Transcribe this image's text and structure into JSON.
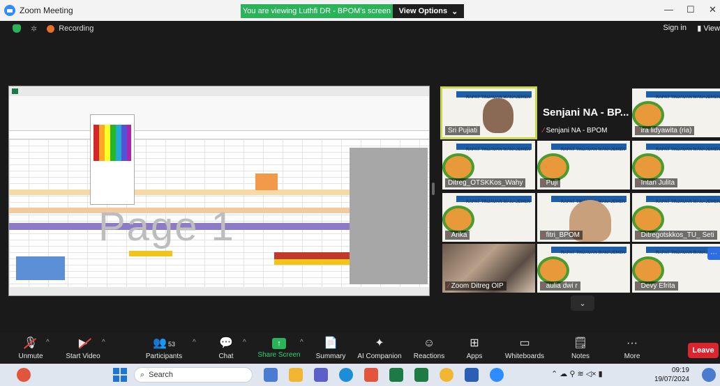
{
  "window": {
    "title": "Zoom Meeting",
    "share_banner": "You are viewing Luthfi DR - BPOM's screen",
    "view_options": "View Options",
    "controls": [
      "—",
      "☐",
      "✕"
    ]
  },
  "status": {
    "recording_label": "Recording",
    "sign_in": "Sign in",
    "view": "View"
  },
  "shared_screen": {
    "watermark": "Page 1"
  },
  "tiles": [
    {
      "name": "Sri Pujiati",
      "muted": false,
      "kind": "face"
    },
    {
      "name": "Senjani NA - BPOM",
      "big_label": "Senjani NA - BP...",
      "muted": true,
      "kind": "dark"
    },
    {
      "name": "ira lidyawita (ria)",
      "muted": true,
      "kind": "slide"
    },
    {
      "name": "Ditreg_OTSKKos_Wahy",
      "muted": false,
      "kind": "slide"
    },
    {
      "name": "Puji",
      "muted": true,
      "kind": "slide"
    },
    {
      "name": "Intan Julita",
      "muted": true,
      "kind": "slide"
    },
    {
      "name": "Arika",
      "muted": true,
      "kind": "slide"
    },
    {
      "name": "fitri_BPOM",
      "muted": true,
      "kind": "hijab"
    },
    {
      "name": "Ditregotskkos_TU_ Seti",
      "muted": true,
      "kind": "slide"
    },
    {
      "name": "Zoom Ditreg OIP",
      "muted": true,
      "kind": "photo"
    },
    {
      "name": "aulia dwi r",
      "muted": true,
      "kind": "slide"
    },
    {
      "name": "Devy Efrita",
      "muted": true,
      "kind": "slide"
    }
  ],
  "slide_header": "RAPAT TINJAUAN MANAJEMEN",
  "toolbar": {
    "unmute": "Unmute",
    "start_video": "Start Video",
    "participants": "Participants",
    "participants_count": "53",
    "chat": "Chat",
    "share_screen": "Share Screen",
    "summary": "Summary",
    "ai_companion": "AI Companion",
    "reactions": "Reactions",
    "apps": "Apps",
    "whiteboards": "Whiteboards",
    "notes": "Notes",
    "more": "More",
    "leave": "Leave"
  },
  "taskbar": {
    "search_placeholder": "Search",
    "time": "09:19",
    "date": "19/07/2024"
  }
}
